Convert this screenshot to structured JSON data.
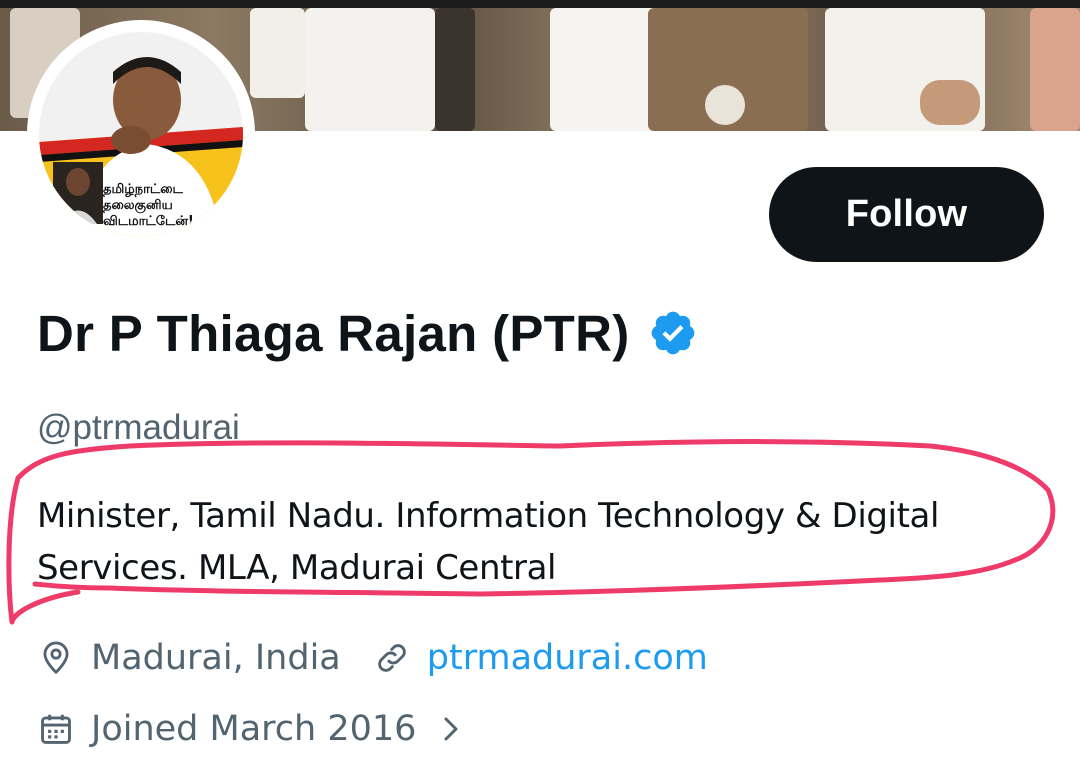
{
  "profile": {
    "display_name": "Dr P Thiaga Rajan (PTR)",
    "handle": "@ptrmadurai",
    "bio": "Minister, Tamil Nadu. Information Technology & Digital Services. MLA, Madurai Central",
    "location": "Madurai, India",
    "website": "ptrmadurai.com",
    "joined": "Joined March 2016",
    "follow_label": "Follow",
    "verified": true,
    "avatar_caption_lines": [
      "தமிழ்நாட்டை",
      "தலைகுனிய",
      "விடமாட்டேன்!"
    ]
  },
  "icons": {
    "verified": "verified-badge-icon",
    "location": "location-pin-icon",
    "link": "link-icon",
    "calendar": "calendar-icon",
    "chevron": "chevron-right-icon"
  },
  "colors": {
    "text_primary": "#0f1419",
    "text_secondary": "#536471",
    "link": "#1d9bf0",
    "verified": "#1d9bf0",
    "button_bg": "#0f1419",
    "annotation": "#ee3b6a"
  }
}
